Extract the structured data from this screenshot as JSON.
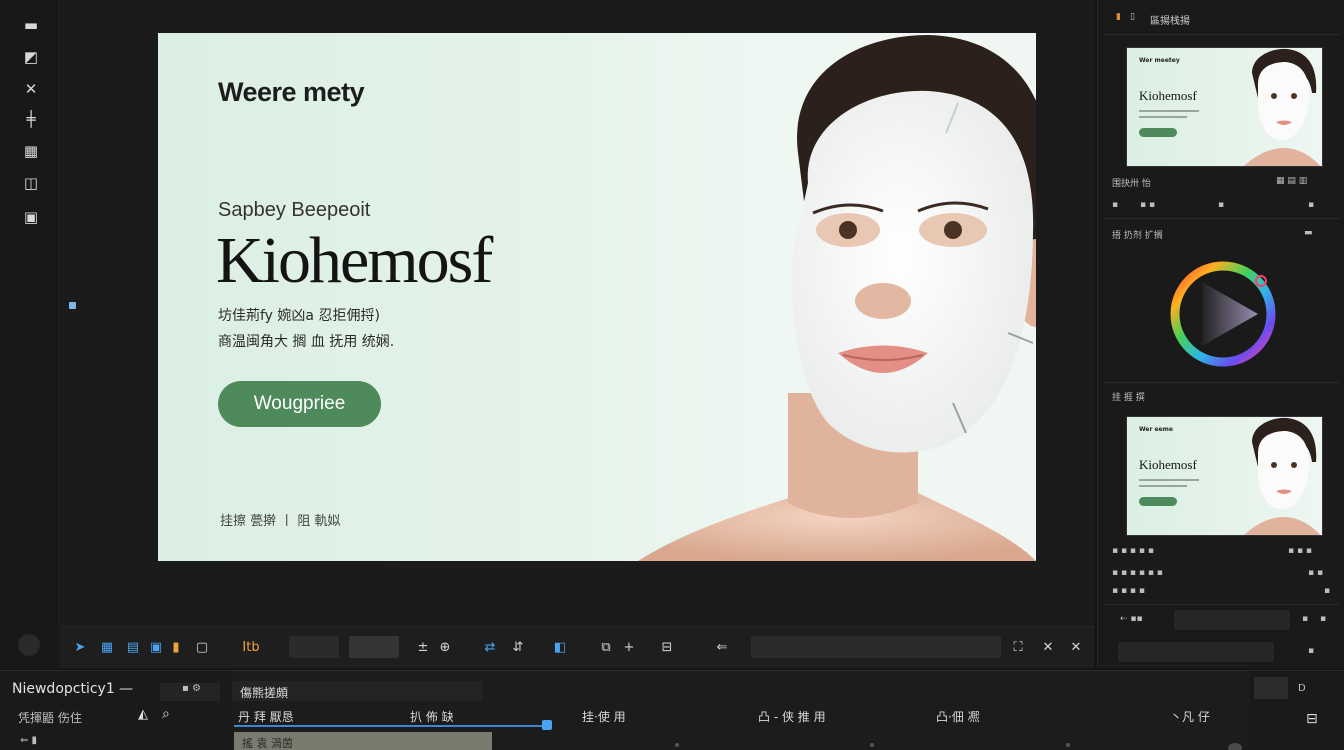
{
  "canvas": {
    "ad": {
      "eyebrow": "Weere mety",
      "subtitle": "Sapbey Beepeoit",
      "title": "Kiohemosf",
      "desc_line1": "坊佳荊fy 婉凶a 忍拒佣捋)",
      "desc_line2": "商温闽角大 搁 血 抚用 统娴.",
      "cta_label": "Wougpriee",
      "footer": "挂擦 甍擀 丨 阻 軌姒"
    }
  },
  "right_panel": {
    "header_top": "區揚栈揚",
    "thumb1": {
      "eyebrow": "Wer meetey",
      "title": "Kiohemosf"
    },
    "row1": "围抉卅 怡",
    "section_color": "捂 扔剂 扩搁",
    "section_preview": "挂 捱 撰",
    "thumb2": {
      "eyebrow": "Wer eeme",
      "title": "Kiohemosf"
    }
  },
  "toolbar": {
    "zoom_label": "Itb",
    "close_glyph": "✕"
  },
  "bottom": {
    "panel_title": "Niewdopcticy1 —",
    "panel_sub": "凭揮鼯  伤住",
    "main_title": "傷熊搓頗",
    "columns": [
      "丹 拜 厭恳",
      "扒 佈 缺",
      "挂·使 用",
      "凸 - 侠 推 用",
      "凸·佃 凞",
      "丶凡 仔"
    ],
    "clip_label": "搖 袁  渦茵"
  },
  "colors": {
    "accent": "#4aa3f0",
    "cta": "#4f8a5c",
    "artboard_bg": "#e4f3ea",
    "panel_bg": "#1a1a1a"
  },
  "icons": {
    "tools": [
      "hand-tool-icon",
      "select-tool-icon",
      "pen-tool-icon",
      "crop-tool-icon",
      "grid-tool-icon",
      "frame-tool-icon",
      "layers-tool-icon"
    ]
  }
}
